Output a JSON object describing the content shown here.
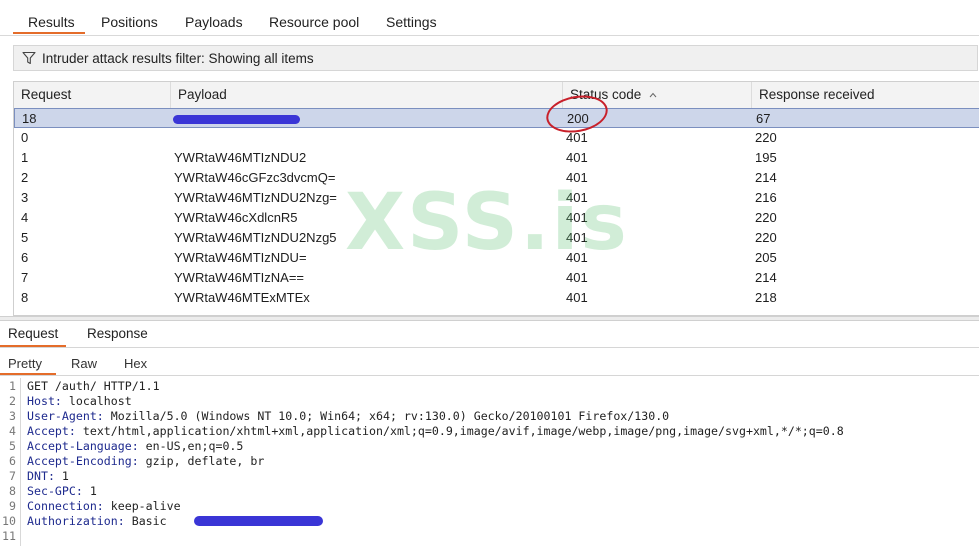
{
  "tabs": [
    "Results",
    "Positions",
    "Payloads",
    "Resource pool",
    "Settings"
  ],
  "filter": {
    "text": "Intruder attack results filter: Showing all items",
    "icon": "funnel-icon"
  },
  "table": {
    "headers": [
      "Request",
      "Payload",
      "Status code",
      "Response received"
    ],
    "sort": "ascending",
    "rows": [
      {
        "request": "18",
        "payload": "",
        "status": "200",
        "response": "67",
        "selected": true
      },
      {
        "request": "0",
        "payload": "",
        "status": "401",
        "response": "220"
      },
      {
        "request": "1",
        "payload": "YWRtaW46MTIzNDU2",
        "status": "401",
        "response": "195"
      },
      {
        "request": "2",
        "payload": "YWRtaW46cGFzc3dvcmQ=",
        "status": "401",
        "response": "214"
      },
      {
        "request": "3",
        "payload": "YWRtaW46MTIzNDU2Nzg=",
        "status": "401",
        "response": "216"
      },
      {
        "request": "4",
        "payload": "YWRtaW46cXdlcnR5",
        "status": "401",
        "response": "220"
      },
      {
        "request": "5",
        "payload": "YWRtaW46MTIzNDU2Nzg5",
        "status": "401",
        "response": "220"
      },
      {
        "request": "6",
        "payload": "YWRtaW46MTIzNDU=",
        "status": "401",
        "response": "205"
      },
      {
        "request": "7",
        "payload": "YWRtaW46MTIzNA==",
        "status": "401",
        "response": "214"
      },
      {
        "request": "8",
        "payload": "YWRtaW46MTExMTEx",
        "status": "401",
        "response": "218"
      }
    ]
  },
  "bottom_tabs": [
    "Request",
    "Response"
  ],
  "view_tabs": [
    "Pretty",
    "Raw",
    "Hex"
  ],
  "request_lines": [
    {
      "n": "1",
      "key": "",
      "val": "GET /auth/ HTTP/1.1"
    },
    {
      "n": "2",
      "key": "Host:",
      "val": " localhost"
    },
    {
      "n": "3",
      "key": "User-Agent:",
      "val": " Mozilla/5.0 (Windows NT 10.0; Win64; x64; rv:130.0) Gecko/20100101 Firefox/130.0"
    },
    {
      "n": "4",
      "key": "Accept:",
      "val": " text/html,application/xhtml+xml,application/xml;q=0.9,image/avif,image/webp,image/png,image/svg+xml,*/*;q=0.8"
    },
    {
      "n": "5",
      "key": "Accept-Language:",
      "val": " en-US,en;q=0.5"
    },
    {
      "n": "6",
      "key": "Accept-Encoding:",
      "val": " gzip, deflate, br"
    },
    {
      "n": "7",
      "key": "DNT:",
      "val": " 1"
    },
    {
      "n": "8",
      "key": "Sec-GPC:",
      "val": " 1"
    },
    {
      "n": "9",
      "key": "Connection:",
      "val": " keep-alive"
    },
    {
      "n": "10",
      "key": "Authorization:",
      "val": " Basic"
    },
    {
      "n": "11",
      "key": "",
      "val": ""
    }
  ],
  "watermark": "XSS.is",
  "colors": {
    "accent": "#e46c2a",
    "selection": "#cdd6ea",
    "redaction": "#3a35d6",
    "annotation": "#c8202a",
    "header_key": "#1e2a8e"
  }
}
